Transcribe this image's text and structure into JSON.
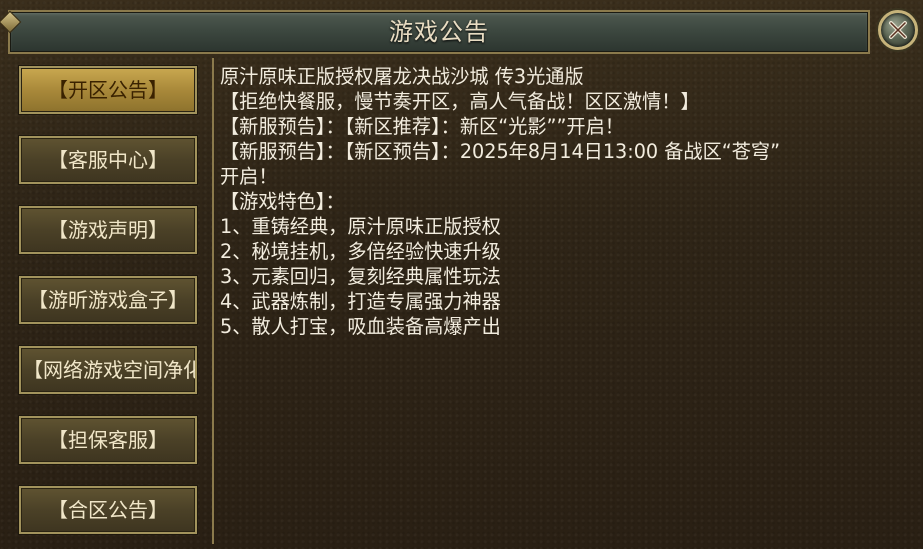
{
  "window": {
    "title": "游戏公告"
  },
  "sidebar": {
    "items": [
      {
        "label": "【开区公告】",
        "active": true
      },
      {
        "label": "【客服中心】",
        "active": false
      },
      {
        "label": "【游戏声明】",
        "active": false
      },
      {
        "label": "【游昕游戏盒子】",
        "active": false
      },
      {
        "label": "【网络游戏空间净化】",
        "active": false
      },
      {
        "label": "【担保客服】",
        "active": false
      },
      {
        "label": "【合区公告】",
        "active": false
      }
    ]
  },
  "announcement": {
    "lines": [
      "原汁原味正版授权屠龙决战沙城 传3光通版",
      "【拒绝快餐服，慢节奏开区，高人气备战！区区激情！】",
      "【新服预告】：【新区推荐】：新区“光影””开启！",
      "【新服预告】：【新区预告】：2025年8月14日13:00 备战区“苍穹”",
      "开启！",
      "【游戏特色】：",
      "1、重铸经典，原汁原味正版授权",
      "2、秘境挂机，多倍经验快速升级",
      "3、元素回归，复刻经典属性玩法",
      "4、武器炼制，打造专属强力神器",
      "5、散人打宝，吸血装备高爆产出"
    ]
  },
  "colors": {
    "active_button": "#b8983f",
    "button": "#4f4529",
    "text": "#f2ecde",
    "border_gold": "#a2935c"
  },
  "icons": {
    "close": "close-icon"
  }
}
